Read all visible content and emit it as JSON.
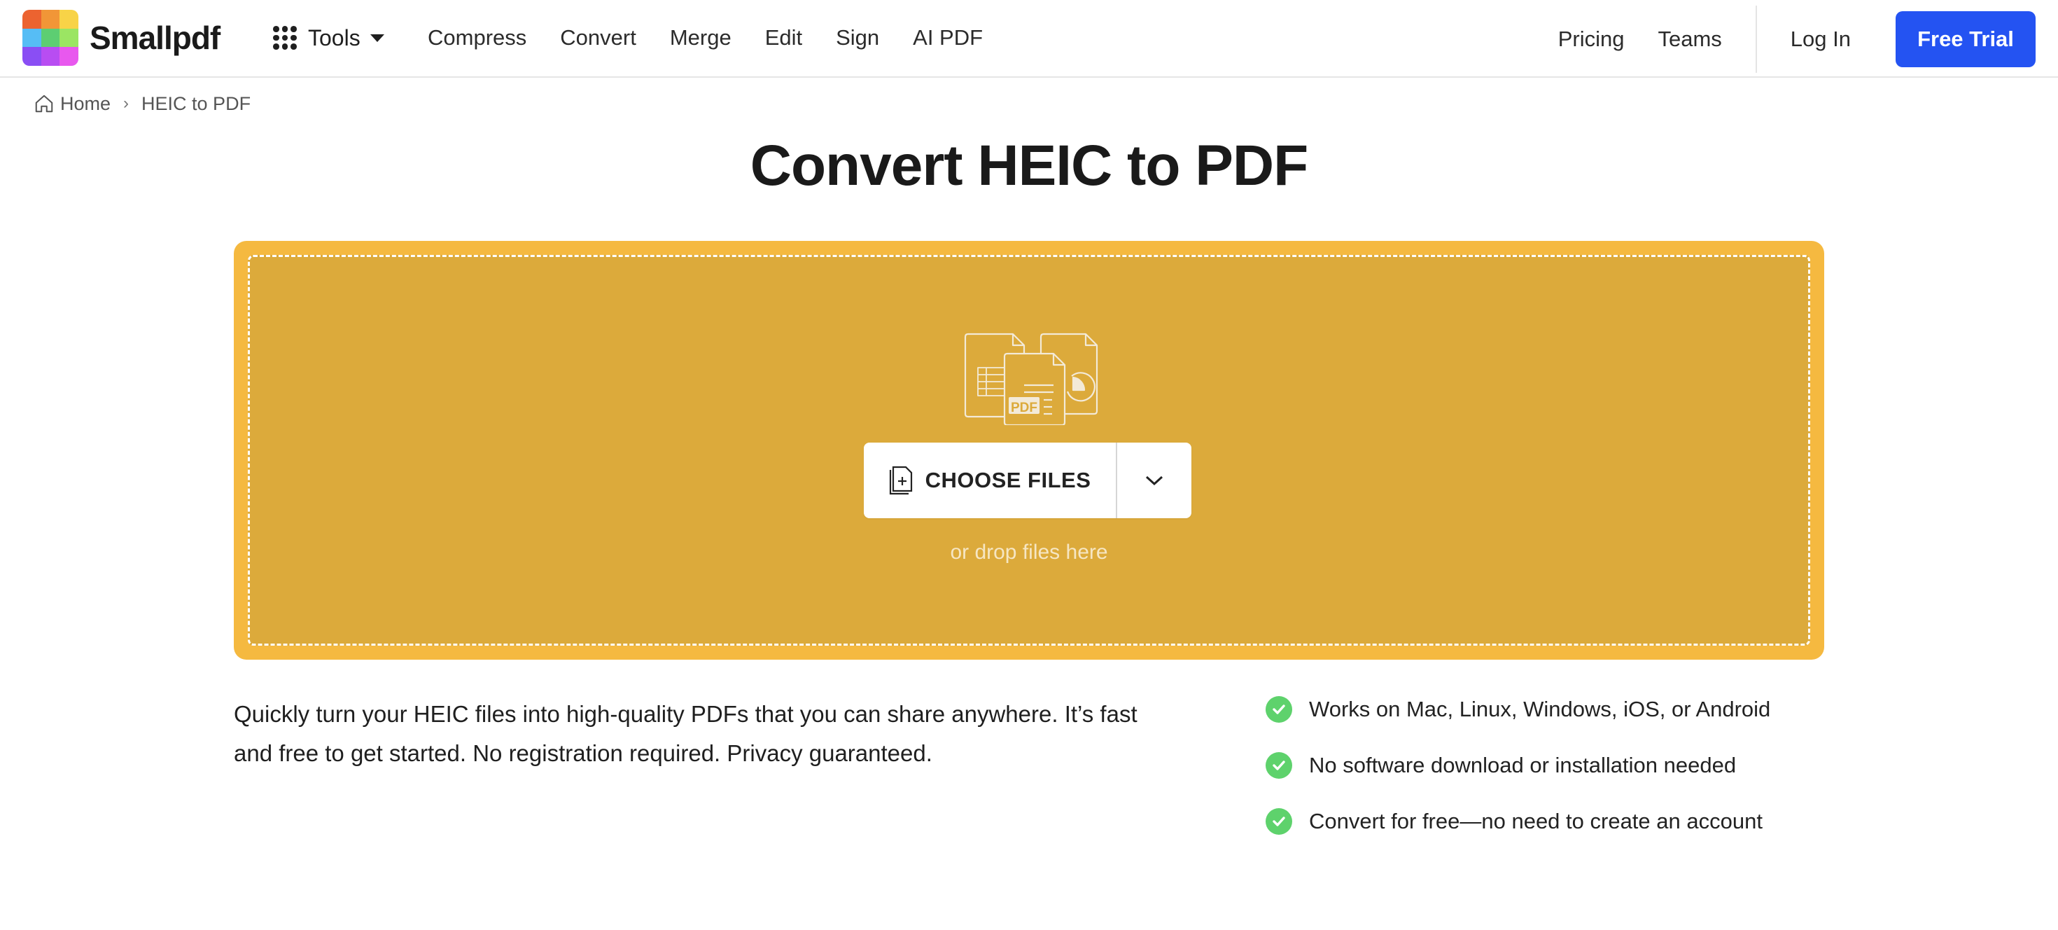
{
  "brand": {
    "name": "Smallpdf",
    "logo_colors": [
      "#ec6330",
      "#f19637",
      "#f8d347",
      "#56bdf5",
      "#5dce72",
      "#9be563",
      "#8a4ef4",
      "#b84df2",
      "#e858ee"
    ]
  },
  "header": {
    "tools_label": "Tools",
    "nav": [
      {
        "label": "Compress"
      },
      {
        "label": "Convert"
      },
      {
        "label": "Merge"
      },
      {
        "label": "Edit"
      },
      {
        "label": "Sign"
      },
      {
        "label": "AI PDF"
      }
    ],
    "right_nav": [
      {
        "label": "Pricing"
      },
      {
        "label": "Teams"
      }
    ],
    "login_label": "Log In",
    "free_trial_label": "Free Trial",
    "accent_color": "#2453f2"
  },
  "breadcrumb": {
    "home": "Home",
    "separator": "›",
    "current": "HEIC to PDF"
  },
  "page": {
    "title": "Convert HEIC to PDF"
  },
  "dropzone": {
    "icon_badge": "PDF",
    "choose_files_label": "CHOOSE FILES",
    "drop_hint": "or drop files here",
    "outer_color": "#f5b940",
    "inner_color": "#dcaa3b"
  },
  "description": "Quickly turn your HEIC files into high-quality PDFs that you can share anywhere. It’s fast and free to get started. No registration required. Privacy guaranteed.",
  "features": [
    {
      "text": "Works on Mac, Linux, Windows, iOS, or Android"
    },
    {
      "text": "No software download or installation needed"
    },
    {
      "text": "Convert for free—no need to create an account"
    }
  ],
  "check_color": "#5ed26c"
}
